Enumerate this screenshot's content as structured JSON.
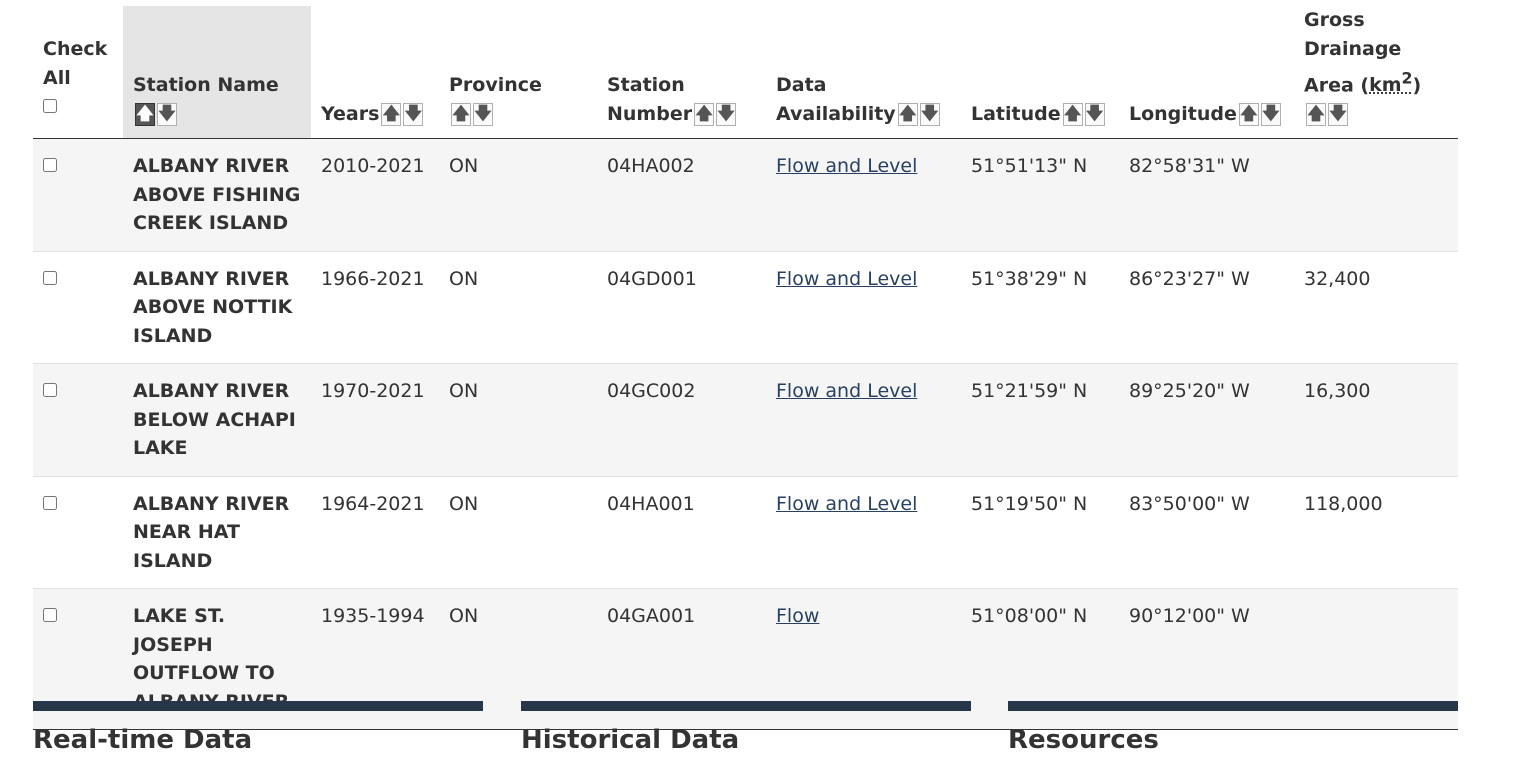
{
  "header": {
    "check_all": "Check All",
    "station_name": "Station Name",
    "years": "Years",
    "province": "Province",
    "station_number": "Station Number",
    "data_availability": "Data Availability",
    "latitude": "Latitude",
    "longitude": "Longitude",
    "drainage_prefix": "Gross Drainage Area (",
    "drainage_unit": "km",
    "drainage_exp": "2",
    "drainage_suffix": ")"
  },
  "sort": {
    "up": "🡅",
    "down": "🡇",
    "active_column": "station_name",
    "active_direction": "up"
  },
  "rows": [
    {
      "name": "ALBANY RIVER ABOVE FISHING CREEK ISLAND",
      "years": "2010-2021",
      "province": "ON",
      "number": "04HA002",
      "availability": "Flow and Level",
      "latitude": "51°51'13\" N",
      "longitude": "82°58'31\" W",
      "area": ""
    },
    {
      "name": "ALBANY RIVER ABOVE NOTTIK ISLAND",
      "years": "1966-2021",
      "province": "ON",
      "number": "04GD001",
      "availability": "Flow and Level",
      "latitude": "51°38'29\" N",
      "longitude": "86°23'27\" W",
      "area": "32,400"
    },
    {
      "name": "ALBANY RIVER BELOW ACHAPI LAKE",
      "years": "1970-2021",
      "province": "ON",
      "number": "04GC002",
      "availability": "Flow and Level",
      "latitude": "51°21'59\" N",
      "longitude": "89°25'20\" W",
      "area": "16,300"
    },
    {
      "name": "ALBANY RIVER NEAR HAT ISLAND",
      "years": "1964-2021",
      "province": "ON",
      "number": "04HA001",
      "availability": "Flow and Level",
      "latitude": "51°19'50\" N",
      "longitude": "83°50'00\" W",
      "area": "118,000"
    },
    {
      "name": "LAKE ST. JOSEPH OUTFLOW TO ALBANY RIVER",
      "years": "1935-1994",
      "province": "ON",
      "number": "04GA001",
      "availability": "Flow",
      "latitude": "51°08'00\" N",
      "longitude": "90°12'00\" W",
      "area": ""
    }
  ],
  "panels": [
    "Real-time Data",
    "Historical Data",
    "Resources"
  ],
  "colors": {
    "panel_bar": "#26374a",
    "link": "#284162",
    "row_alt": "#f5f5f5",
    "sorted_header": "#e5e5e5"
  }
}
